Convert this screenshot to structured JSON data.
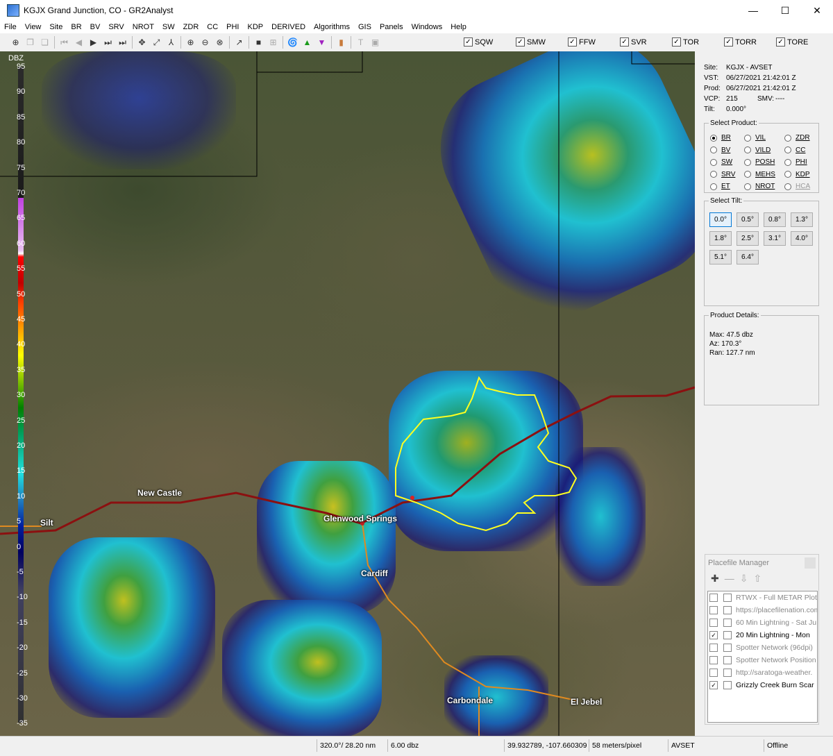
{
  "window": {
    "title": "KGJX Grand Junction, CO - GR2Analyst",
    "min": "—",
    "max": "☐",
    "close": "✕"
  },
  "menu": [
    "File",
    "View",
    "Site",
    "BR",
    "BV",
    "SRV",
    "NROT",
    "SW",
    "ZDR",
    "CC",
    "PHI",
    "KDP",
    "DERIVED",
    "Algorithms",
    "GIS",
    "Panels",
    "Windows",
    "Help"
  ],
  "warnings": [
    {
      "label": "SQW",
      "checked": "✓"
    },
    {
      "label": "SMW",
      "checked": "✓"
    },
    {
      "label": "FFW",
      "checked": "✓"
    },
    {
      "label": "SVR",
      "checked": "✓"
    },
    {
      "label": "TOR",
      "checked": "✓"
    },
    {
      "label": "TORR",
      "checked": "✓"
    },
    {
      "label": "TORE",
      "checked": "✓"
    }
  ],
  "legend": {
    "unit": "DBZ",
    "ticks": [
      "95",
      "90",
      "85",
      "80",
      "75",
      "70",
      "65",
      "60",
      "55",
      "50",
      "45",
      "40",
      "35",
      "30",
      "25",
      "20",
      "15",
      "10",
      "5",
      "0",
      "-5",
      "-10",
      "-15",
      "-20",
      "-25",
      "-30",
      "-35"
    ]
  },
  "towns": {
    "silt": "Silt",
    "new_castle": "New Castle",
    "glenwood": "Glenwood Springs",
    "cardiff": "Cardiff",
    "carbondale": "Carbondale",
    "el_jebel": "El Jebel"
  },
  "info": {
    "site_k": "Site:",
    "site_v": "KGJX - AVSET",
    "vst_k": "VST:",
    "vst_v": "06/27/2021  21:42:01 Z",
    "prod_k": "Prod:",
    "prod_v": "06/27/2021  21:42:01 Z",
    "vcp_k": "VCP:",
    "vcp_v": "215",
    "smv_k": "SMV:",
    "smv_v": "----",
    "tilt_k": "Tilt:",
    "tilt_v": "0.000°"
  },
  "select_product": {
    "title": "Select Product:",
    "items": [
      "BR",
      "VIL",
      "ZDR",
      "BV",
      "VILD",
      "CC",
      "SW",
      "POSH",
      "PHI",
      "SRV",
      "MEHS",
      "KDP",
      "ET",
      "NROT",
      "HCA"
    ]
  },
  "select_tilt": {
    "title": "Select Tilt:",
    "items": [
      "0.0°",
      "0.5°",
      "0.8°",
      "1.3°",
      "1.8°",
      "2.5°",
      "3.1°",
      "4.0°",
      "5.1°",
      "6.4°"
    ]
  },
  "product_details": {
    "title": "Product Details:",
    "max": "Max:  47.5 dbz",
    "az": "Az:  170.3°",
    "ran": "Ran:  127.7 nm"
  },
  "placefile": {
    "title": "Placefile Manager",
    "rows": [
      {
        "label": "RTWX - Full METAR Plot",
        "checked": ""
      },
      {
        "label": "https://placefilenation.com",
        "checked": ""
      },
      {
        "label": "60 Min Lightning - Sat Ju",
        "checked": ""
      },
      {
        "label": "20 Min Lightning - Mon",
        "checked": "✓"
      },
      {
        "label": "Spotter Network (96dpi)",
        "checked": ""
      },
      {
        "label": "Spotter Network Position",
        "checked": ""
      },
      {
        "label": "http://saratoga-weather.",
        "checked": ""
      },
      {
        "label": "Grizzly Creek Burn Scar",
        "checked": "✓"
      }
    ]
  },
  "status": {
    "azran": "320.0°/ 28.20 nm",
    "value": "6.00 dbz",
    "coords": "39.932789, -107.660309",
    "scale": "58 meters/pixel",
    "site": "AVSET",
    "conn": "Offline"
  }
}
